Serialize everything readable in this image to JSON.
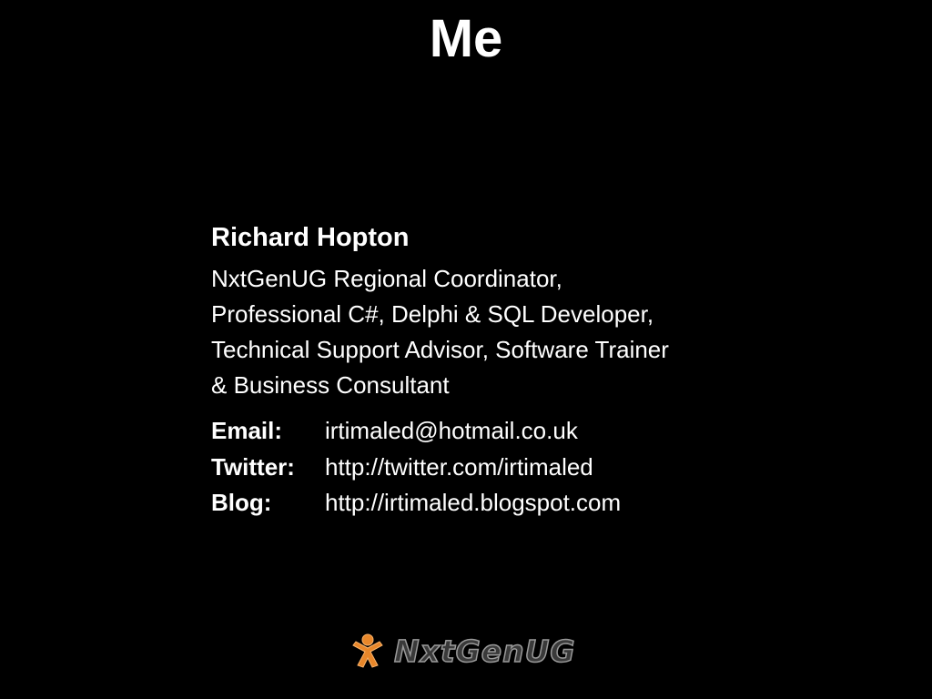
{
  "slide": {
    "title": "Me"
  },
  "profile": {
    "name": "Richard Hopton",
    "roles": [
      "NxtGenUG Regional Coordinator,",
      "Professional C#, Delphi & SQL Developer,",
      "Technical Support Advisor, Software Trainer",
      "& Business Consultant"
    ],
    "contacts": [
      {
        "label": "Email:",
        "value": "irtimaled@hotmail.co.uk"
      },
      {
        "label": "Twitter:",
        "value": "http://twitter.com/irtimaled"
      },
      {
        "label": "Blog:",
        "value": "http://irtimaled.blogspot.com"
      }
    ]
  },
  "logo": {
    "text": "NxtGenUG",
    "icon": "running-figure-icon",
    "colors": {
      "figure": "#e8872a",
      "text_fill": "#3a3a3a",
      "text_outline": "#9a9a9a"
    }
  },
  "colors": {
    "background": "#000000",
    "text": "#ffffff"
  }
}
